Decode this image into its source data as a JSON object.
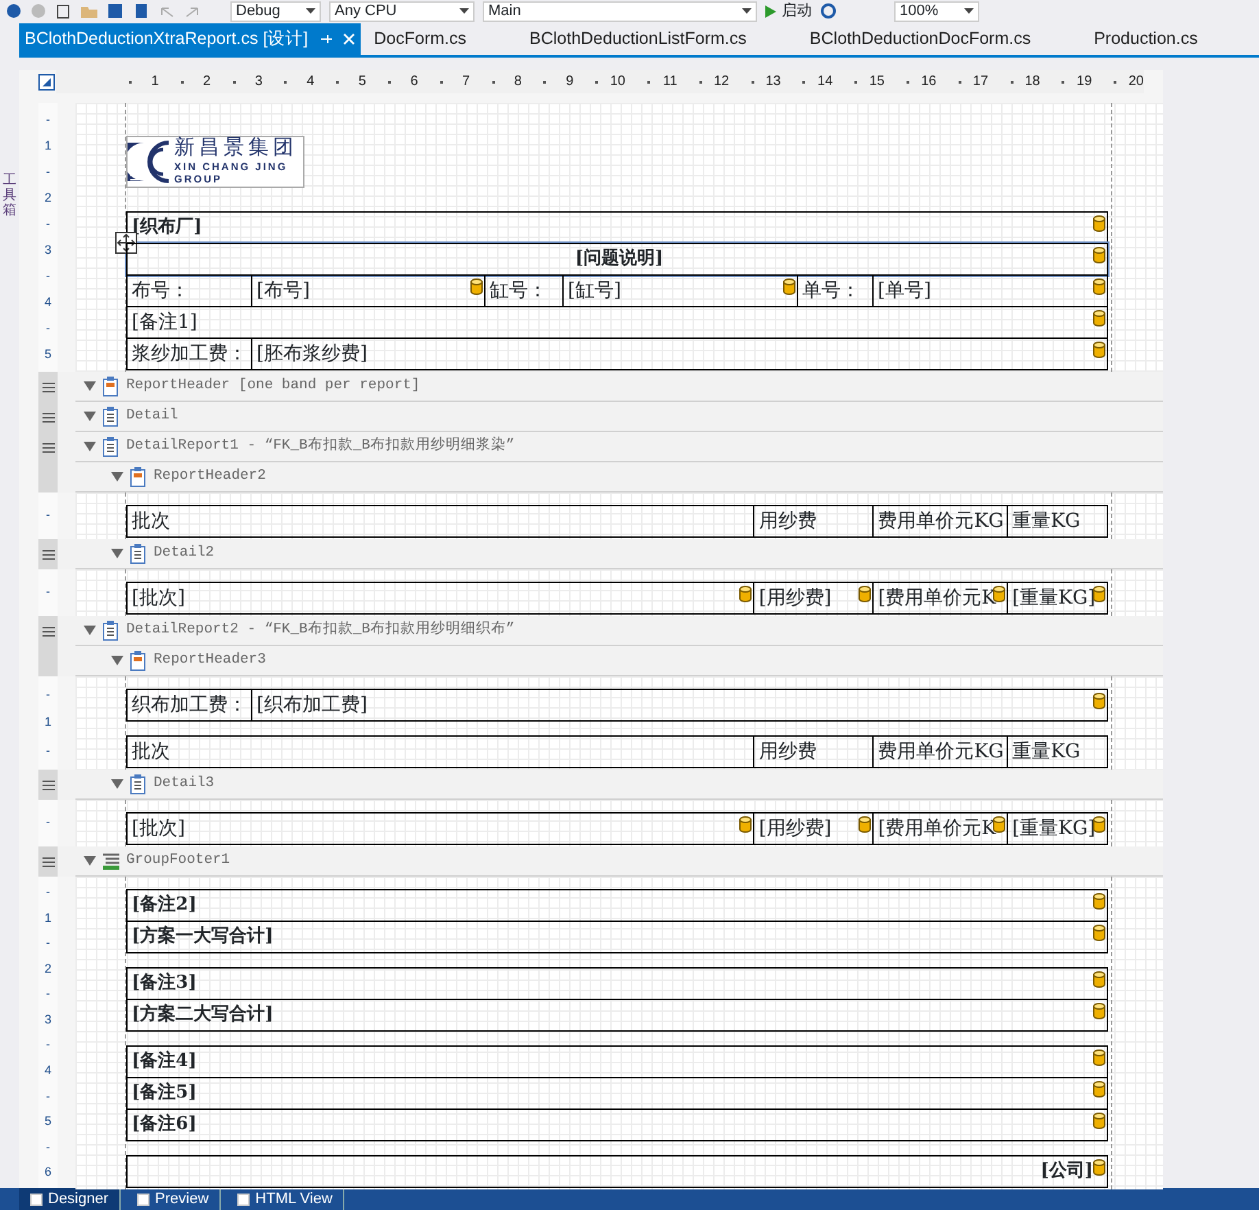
{
  "toolbar": {
    "configuration": "Debug",
    "platform": "Any CPU",
    "project": "Main",
    "start": "启动",
    "zoom": "100%"
  },
  "side_tabs": [
    {
      "label": "工具箱"
    }
  ],
  "tabs": [
    {
      "label": "BClothDeductionXtraReport.cs [设计]",
      "selected": true
    },
    {
      "label": "DocForm.cs",
      "selected": false
    },
    {
      "label": "BClothDeductionListForm.cs",
      "selected": false
    },
    {
      "label": "BClothDeductionDocForm.cs",
      "selected": false
    },
    {
      "label": "Production.cs",
      "selected": false
    }
  ],
  "ruler": [
    "1",
    "2",
    "3",
    "4",
    "5",
    "6",
    "7",
    "8",
    "9",
    "10",
    "11",
    "12",
    "13",
    "14",
    "15",
    "16",
    "17",
    "18",
    "19",
    "20"
  ],
  "sections": [
    {
      "kind": "content",
      "vruler": [
        "-",
        "1",
        "-",
        "2",
        "-",
        "3",
        "-",
        "4",
        "-",
        "5"
      ],
      "logo": {
        "name_cn": "新昌景集团",
        "name_en": "XIN CHANG JING",
        "group": "GROUP"
      },
      "blocks": [
        [
          {
            "kind": "full",
            "selected": false,
            "cells": [
              {
                "text": "[织布厂]",
                "bold": true,
                "bound": true
              }
            ]
          },
          {
            "kind": "title",
            "selected": true,
            "cells": [
              {
                "text": "[问题说明]",
                "bold": true,
                "bound": true
              }
            ]
          },
          {
            "kind": "three-pairs",
            "selected": false,
            "cells": [
              {
                "text": "布号：",
                "bold": false,
                "bound": false
              },
              {
                "text": "[布号]",
                "bold": false,
                "bound": true
              },
              {
                "text": "缸号：",
                "bold": false,
                "bound": false
              },
              {
                "text": "[缸号]",
                "bold": false,
                "bound": true
              },
              {
                "text": "单号：",
                "bold": false,
                "bound": false
              },
              {
                "text": "[单号]",
                "bold": false,
                "bound": true
              }
            ]
          },
          {
            "kind": "full",
            "selected": false,
            "cells": [
              {
                "text": "[备注1]",
                "bold": false,
                "bound": true
              }
            ]
          },
          {
            "kind": "label-value",
            "selected": false,
            "cells": [
              {
                "text": "浆纱加工费：",
                "bold": false,
                "bound": false
              },
              {
                "text": "[胚布浆纱费]",
                "bold": false,
                "bound": true
              }
            ]
          }
        ]
      ]
    },
    {
      "kind": "report-header",
      "label": "ReportHeader [one band per report]",
      "grip": true,
      "expanded": true
    },
    {
      "kind": "detail",
      "label": "Detail",
      "grip": true,
      "expanded": true
    },
    {
      "kind": "detail-report",
      "label": "DetailReport1 - “FK_B布扣款_B布扣款用纱明细浆染”",
      "grip": true,
      "expanded": true,
      "children": [
        {
          "kind": "report-header",
          "label": "ReportHeader2",
          "grip": false,
          "expanded": true,
          "content": {
            "vruler": [
              "-"
            ],
            "blocks": [
              [
                {
                  "kind": "table",
                  "selected": false,
                  "cells": [
                    {
                      "text": "批次",
                      "bold": false,
                      "bound": false
                    },
                    {
                      "text": "用纱费",
                      "bold": false,
                      "bound": false
                    },
                    {
                      "text": "费用单价元KG",
                      "bold": false,
                      "bound": false
                    },
                    {
                      "text": "重量KG",
                      "bold": false,
                      "bound": false
                    }
                  ]
                }
              ]
            ]
          }
        },
        {
          "kind": "detail",
          "label": "Detail2",
          "grip": true,
          "expanded": true,
          "content": {
            "vruler": [
              "-"
            ],
            "blocks": [
              [
                {
                  "kind": "table",
                  "selected": false,
                  "cells": [
                    {
                      "text": "[批次]",
                      "bold": false,
                      "bound": true
                    },
                    {
                      "text": "[用纱费]",
                      "bold": false,
                      "bound": true
                    },
                    {
                      "text": "[费用单价元K",
                      "bold": false,
                      "bound": true
                    },
                    {
                      "text": "[重量KG]",
                      "bold": false,
                      "bound": true
                    }
                  ]
                }
              ]
            ]
          }
        }
      ]
    },
    {
      "kind": "detail-report",
      "label": "DetailReport2 - “FK_B布扣款_B布扣款用纱明细织布”",
      "grip": true,
      "expanded": true,
      "children": [
        {
          "kind": "report-header",
          "label": "ReportHeader3",
          "grip": false,
          "expanded": true,
          "content": {
            "vruler": [
              "-",
              "1",
              "-"
            ],
            "blocks": [
              [
                {
                  "kind": "label-value",
                  "selected": false,
                  "cells": [
                    {
                      "text": "织布加工费：",
                      "bold": false,
                      "bound": false
                    },
                    {
                      "text": "[织布加工费]",
                      "bold": false,
                      "bound": true
                    }
                  ]
                }
              ],
              [
                {
                  "kind": "table",
                  "selected": false,
                  "cells": [
                    {
                      "text": "批次",
                      "bold": false,
                      "bound": false
                    },
                    {
                      "text": "用纱费",
                      "bold": false,
                      "bound": false
                    },
                    {
                      "text": "费用单价元KG",
                      "bold": false,
                      "bound": false
                    },
                    {
                      "text": "重量KG",
                      "bold": false,
                      "bound": false
                    }
                  ]
                }
              ]
            ]
          }
        },
        {
          "kind": "detail",
          "label": "Detail3",
          "grip": true,
          "expanded": true,
          "content": {
            "vruler": [
              "-"
            ],
            "blocks": [
              [
                {
                  "kind": "table",
                  "selected": false,
                  "cells": [
                    {
                      "text": "[批次]",
                      "bold": false,
                      "bound": true
                    },
                    {
                      "text": "[用纱费]",
                      "bold": false,
                      "bound": true
                    },
                    {
                      "text": "[费用单价元K",
                      "bold": false,
                      "bound": true
                    },
                    {
                      "text": "[重量KG]",
                      "bold": false,
                      "bound": true
                    }
                  ]
                }
              ]
            ]
          }
        }
      ]
    },
    {
      "kind": "group-footer",
      "label": "GroupFooter1",
      "grip": true,
      "expanded": true,
      "content": {
        "vruler": [
          "-",
          "1",
          "-",
          "2",
          "-",
          "3",
          "-",
          "4",
          "-",
          "5",
          "-",
          "6"
        ],
        "blocks": [
          [
            {
              "kind": "full",
              "selected": false,
              "cells": [
                {
                  "text": "[备注2]",
                  "bold": true,
                  "bound": true
                }
              ]
            },
            {
              "kind": "full",
              "selected": false,
              "cells": [
                {
                  "text": "[方案一大写合计]",
                  "bold": true,
                  "bound": true
                }
              ]
            }
          ],
          [
            {
              "kind": "full",
              "selected": false,
              "cells": [
                {
                  "text": "[备注3]",
                  "bold": true,
                  "bound": true
                }
              ]
            },
            {
              "kind": "full",
              "selected": false,
              "cells": [
                {
                  "text": "[方案二大写合计]",
                  "bold": true,
                  "bound": true
                }
              ]
            }
          ],
          [
            {
              "kind": "full",
              "selected": false,
              "cells": [
                {
                  "text": "[备注4]",
                  "bold": true,
                  "bound": true
                }
              ]
            },
            {
              "kind": "full",
              "selected": false,
              "cells": [
                {
                  "text": "[备注5]",
                  "bold": true,
                  "bound": true
                }
              ]
            },
            {
              "kind": "full",
              "selected": false,
              "cells": [
                {
                  "text": "[备注6]",
                  "bold": true,
                  "bound": true
                }
              ]
            }
          ],
          [
            {
              "kind": "full-right",
              "selected": false,
              "cells": [
                {
                  "text": "[公司]",
                  "bold": true,
                  "bound": true
                }
              ]
            }
          ]
        ]
      }
    }
  ],
  "bottom_tabs": [
    {
      "label": "Designer",
      "selected": true
    },
    {
      "label": "Preview",
      "selected": false
    },
    {
      "label": "HTML View",
      "selected": false
    }
  ]
}
